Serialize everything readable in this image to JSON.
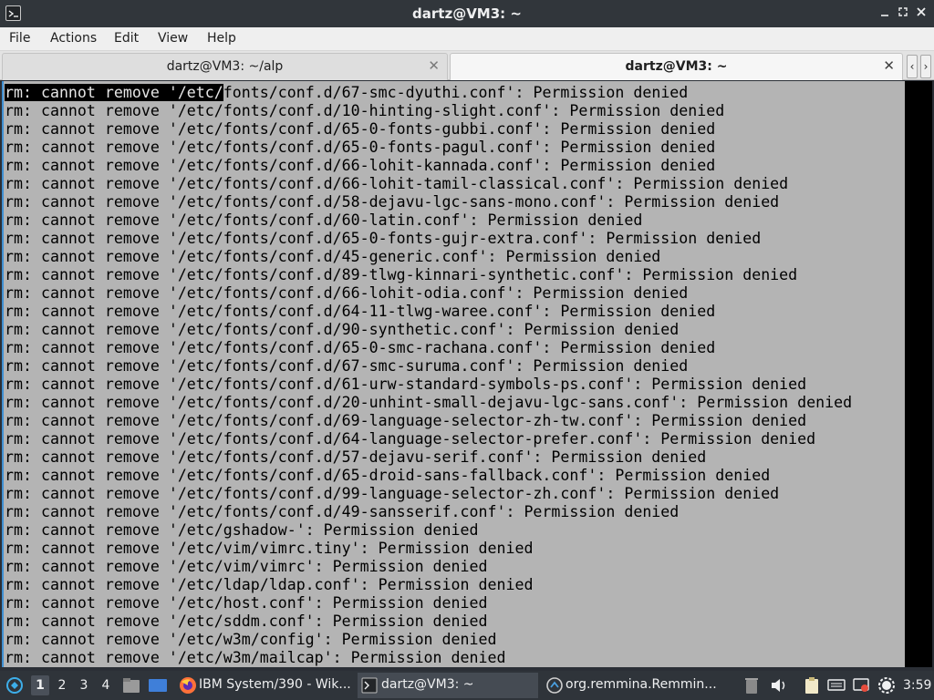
{
  "window": {
    "title": "dartz@VM3: ~"
  },
  "menu": [
    "File",
    "Actions",
    "Edit",
    "View",
    "Help"
  ],
  "tabs": [
    {
      "label": "dartz@VM3: ~/alp",
      "active": false
    },
    {
      "label": "dartz@VM3: ~",
      "active": true
    }
  ],
  "terminal": {
    "selected_prefix": "rm: cannot remove '/etc/",
    "first_line_rest": "fonts/conf.d/67-smc-dyuthi.conf': Permission denied",
    "lines": [
      "rm: cannot remove '/etc/fonts/conf.d/10-hinting-slight.conf': Permission denied",
      "rm: cannot remove '/etc/fonts/conf.d/65-0-fonts-gubbi.conf': Permission denied",
      "rm: cannot remove '/etc/fonts/conf.d/65-0-fonts-pagul.conf': Permission denied",
      "rm: cannot remove '/etc/fonts/conf.d/66-lohit-kannada.conf': Permission denied",
      "rm: cannot remove '/etc/fonts/conf.d/66-lohit-tamil-classical.conf': Permission denied",
      "rm: cannot remove '/etc/fonts/conf.d/58-dejavu-lgc-sans-mono.conf': Permission denied",
      "rm: cannot remove '/etc/fonts/conf.d/60-latin.conf': Permission denied",
      "rm: cannot remove '/etc/fonts/conf.d/65-0-fonts-gujr-extra.conf': Permission denied",
      "rm: cannot remove '/etc/fonts/conf.d/45-generic.conf': Permission denied",
      "rm: cannot remove '/etc/fonts/conf.d/89-tlwg-kinnari-synthetic.conf': Permission denied",
      "rm: cannot remove '/etc/fonts/conf.d/66-lohit-odia.conf': Permission denied",
      "rm: cannot remove '/etc/fonts/conf.d/64-11-tlwg-waree.conf': Permission denied",
      "rm: cannot remove '/etc/fonts/conf.d/90-synthetic.conf': Permission denied",
      "rm: cannot remove '/etc/fonts/conf.d/65-0-smc-rachana.conf': Permission denied",
      "rm: cannot remove '/etc/fonts/conf.d/67-smc-suruma.conf': Permission denied",
      "rm: cannot remove '/etc/fonts/conf.d/61-urw-standard-symbols-ps.conf': Permission denied",
      "rm: cannot remove '/etc/fonts/conf.d/20-unhint-small-dejavu-lgc-sans.conf': Permission denied",
      "rm: cannot remove '/etc/fonts/conf.d/69-language-selector-zh-tw.conf': Permission denied",
      "rm: cannot remove '/etc/fonts/conf.d/64-language-selector-prefer.conf': Permission denied",
      "rm: cannot remove '/etc/fonts/conf.d/57-dejavu-serif.conf': Permission denied",
      "rm: cannot remove '/etc/fonts/conf.d/65-droid-sans-fallback.conf': Permission denied",
      "rm: cannot remove '/etc/fonts/conf.d/99-language-selector-zh.conf': Permission denied",
      "rm: cannot remove '/etc/fonts/conf.d/49-sansserif.conf': Permission denied",
      "rm: cannot remove '/etc/gshadow-': Permission denied",
      "rm: cannot remove '/etc/vim/vimrc.tiny': Permission denied",
      "rm: cannot remove '/etc/vim/vimrc': Permission denied",
      "rm: cannot remove '/etc/ldap/ldap.conf': Permission denied",
      "rm: cannot remove '/etc/host.conf': Permission denied",
      "rm: cannot remove '/etc/sddm.conf': Permission denied",
      "rm: cannot remove '/etc/w3m/config': Permission denied",
      "rm: cannot remove '/etc/w3m/mailcap': Permission denied"
    ]
  },
  "taskbar": {
    "workspaces": [
      "1",
      "2",
      "3",
      "4"
    ],
    "active_workspace": "1",
    "tasks": [
      {
        "label": "IBM System/390 - Wik...",
        "icon": "firefox-icon"
      },
      {
        "label": "dartz@VM3: ~",
        "icon": "terminal-icon"
      },
      {
        "label": "org.remmina.Remmin...",
        "icon": "remmina-icon"
      }
    ],
    "clock": "3:59"
  },
  "colors": {
    "terminal_bg": "#b4b4b4",
    "terminal_fg": "#000000",
    "selection_bg": "#000000",
    "titlebar_bg": "#31363b",
    "taskbar_bg": "#2f343a"
  }
}
